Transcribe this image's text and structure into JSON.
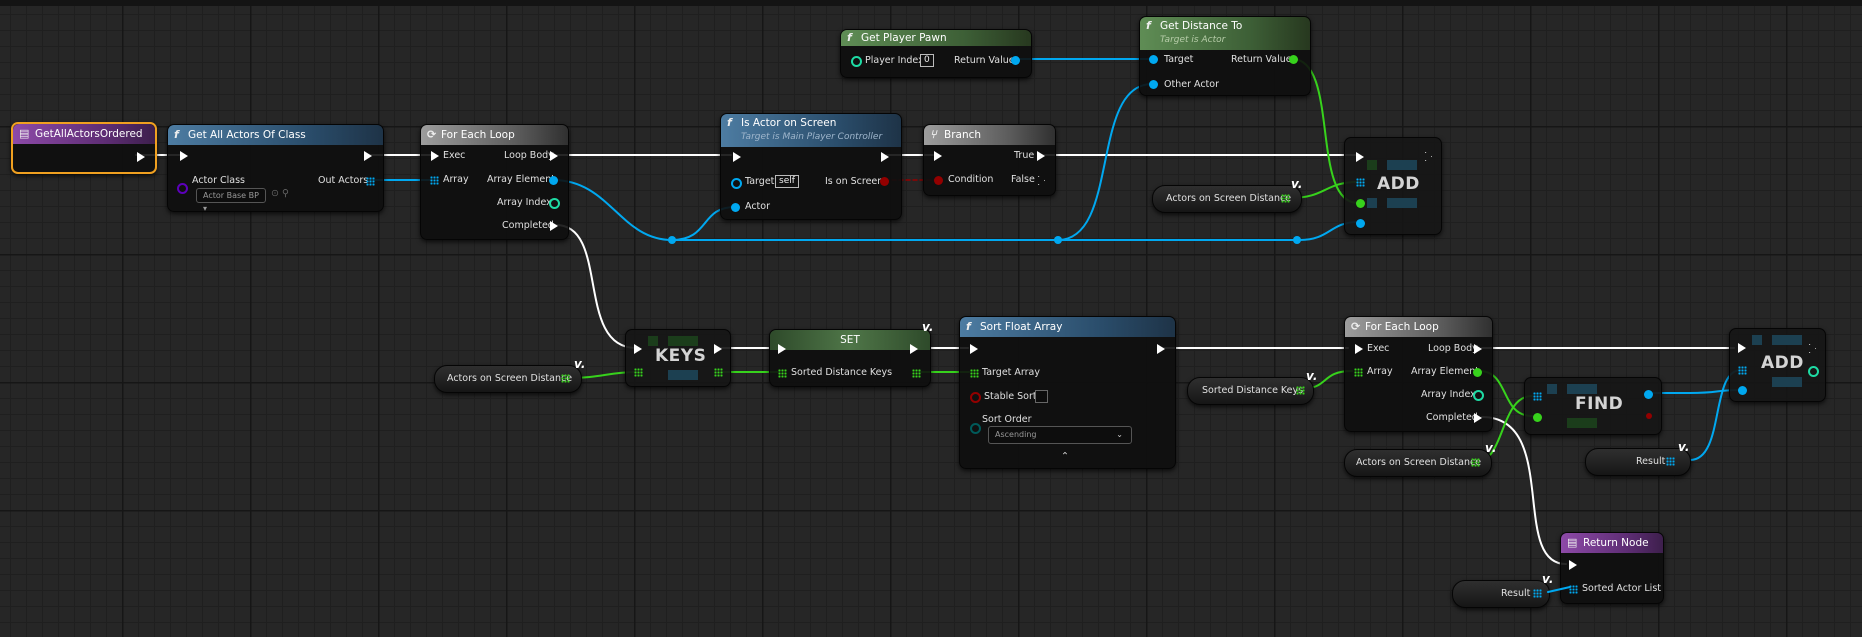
{
  "event_node": {
    "title": "GetAllActorsOrdered"
  },
  "get_all_actors": {
    "title": "Get All Actors Of Class",
    "actor_class_label": "Actor Class",
    "actor_class_value": "Actor Base BP",
    "out_actors": "Out Actors"
  },
  "for_each_1": {
    "title": "For Each Loop",
    "exec": "Exec",
    "array": "Array",
    "loop_body": "Loop Body",
    "array_element": "Array Element",
    "array_index": "Array Index",
    "completed": "Completed"
  },
  "get_player_pawn": {
    "title": "Get Player Pawn",
    "player_index": "Player Index",
    "player_index_value": "0",
    "return_value": "Return Value"
  },
  "is_actor_on_screen": {
    "title": "Is Actor on Screen",
    "subtitle": "Target is Main Player Controller",
    "target": "Target",
    "target_value": "self",
    "actor": "Actor",
    "is_on_screen": "Is on Screen"
  },
  "branch": {
    "title": "Branch",
    "condition": "Condition",
    "true_label": "True",
    "false_label": "False"
  },
  "get_distance": {
    "title": "Get Distance To",
    "subtitle": "Target is Actor",
    "target": "Target",
    "other_actor": "Other Actor",
    "return_value": "Return Value"
  },
  "add_1": {
    "label": "ADD"
  },
  "var_actors_distance_1": {
    "label": "Actors on Screen Distance"
  },
  "var_actors_distance_2": {
    "label": "Actors on Screen Distance"
  },
  "var_actors_distance_3": {
    "label": "Actors on Screen Distance"
  },
  "keys": {
    "label": "KEYS"
  },
  "set_node": {
    "title": "SET",
    "sorted_keys": "Sorted Distance Keys"
  },
  "sort_float": {
    "title": "Sort Float Array",
    "target_array": "Target Array",
    "stable_sort": "Stable Sort",
    "sort_order": "Sort Order",
    "sort_order_value": "Ascending"
  },
  "var_sorted_keys": {
    "label": "Sorted Distance Keys"
  },
  "for_each_2": {
    "title": "For Each Loop",
    "exec": "Exec",
    "array": "Array",
    "loop_body": "Loop Body",
    "array_element": "Array Element",
    "array_index": "Array Index",
    "completed": "Completed"
  },
  "find": {
    "label": "FIND"
  },
  "add_2": {
    "label": "ADD"
  },
  "var_result_1": {
    "label": "Result"
  },
  "var_result_2": {
    "label": "Result"
  },
  "return_node": {
    "title": "Return Node",
    "sorted_actor_list": "Sorted Actor List"
  },
  "colors": {
    "exec": "#ffffff",
    "object": "#00a8f0",
    "float": "#37d21c",
    "bool": "#930000",
    "class": "#5c00ba",
    "int": "#1edba4",
    "enum": "#005a5a"
  },
  "icons": {
    "function": "f-icon",
    "loop": "loop-icon",
    "branch": "branch-icon",
    "event": "event-icon",
    "variable": "variable-icon"
  }
}
